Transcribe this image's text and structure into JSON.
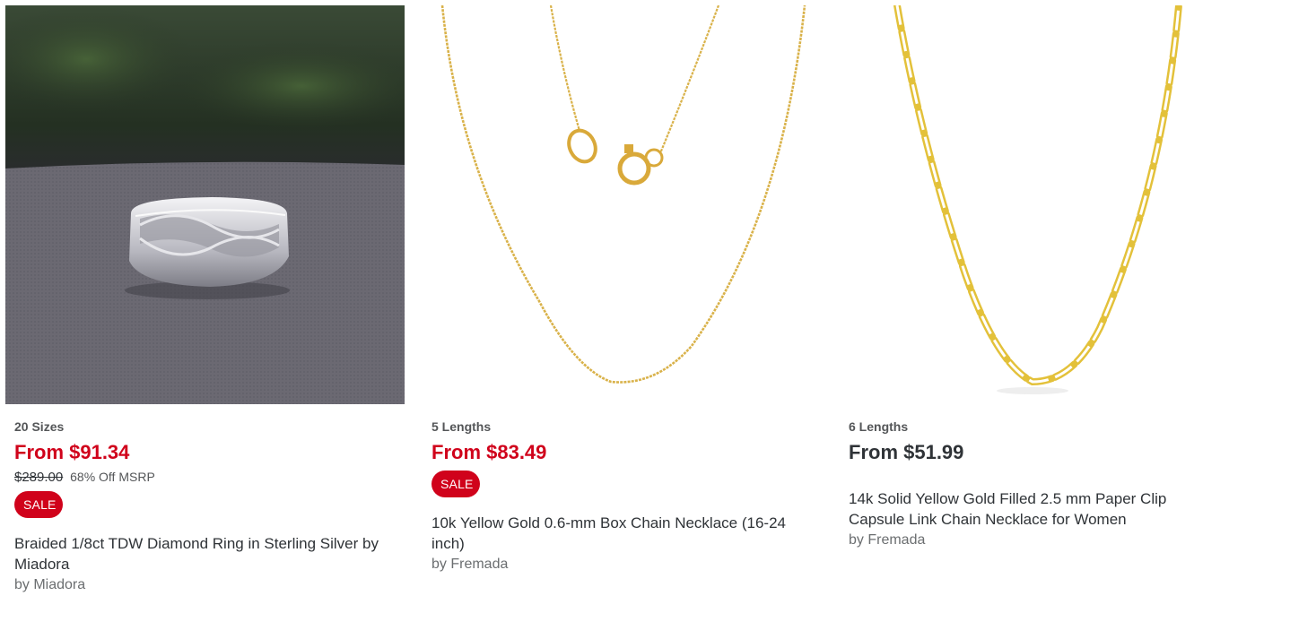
{
  "products": [
    {
      "variant_label": "20 Sizes",
      "price": "From $91.34",
      "msrp": "$289.00",
      "discount": "68% Off MSRP",
      "badge": "SALE",
      "title": "Braided 1/8ct TDW Diamond Ring in Sterling Silver by Miadora",
      "brand": "by Miadora",
      "image_icon": "diamond-ring-image"
    },
    {
      "variant_label": "5 Lengths",
      "price": "From $83.49",
      "badge": "SALE",
      "title": "10k Yellow Gold 0.6-mm Box Chain Necklace (16-24 inch)",
      "brand": "by Fremada",
      "image_icon": "box-chain-necklace-image"
    },
    {
      "variant_label": "6 Lengths",
      "price": "From $51.99",
      "title": "14k Solid Yellow Gold Filled 2.5 mm Paper Clip Capsule Link Chain Necklace for Women",
      "brand": "by Fremada",
      "image_icon": "paper-clip-chain-necklace-image"
    }
  ],
  "colors": {
    "sale_red": "#d0021b",
    "text_dark": "#2f3337",
    "text_muted": "#6b6e70",
    "gold": "#d9b24a"
  }
}
